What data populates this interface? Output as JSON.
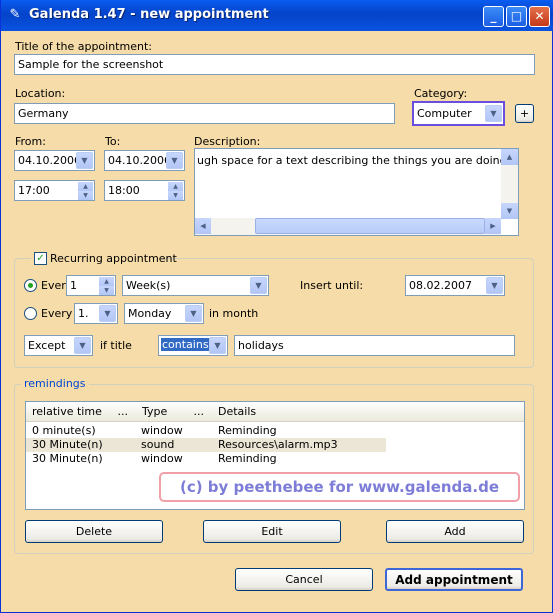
{
  "window": {
    "title": "Galenda 1.47 - new appointment",
    "min": "_",
    "max": "□",
    "close": "✕"
  },
  "appointment": {
    "title_label": "Title of the appointment:",
    "title_value": "Sample for the screenshot",
    "location_label": "Location:",
    "location_value": "Germany",
    "category_label": "Category:",
    "category_value": "Computer",
    "category_add": "+",
    "from_label": "From:",
    "to_label": "To:",
    "from_date": "04.10.2006",
    "to_date": "04.10.2006",
    "from_time": "17:00",
    "to_time": "18:00",
    "description_label": "Description:",
    "description_value": "ugh space for a text describing the things you are doing all the day."
  },
  "recurring": {
    "label": "Recurring appointment",
    "checked": true,
    "every_label": "Every",
    "every_value": "1",
    "every_unit": "Week(s)",
    "insert_until_label": "Insert until:",
    "insert_until_value": "08.02.2007",
    "every2_label": "Every",
    "nth_value": "1.",
    "weekday_value": "Monday",
    "in_month": "in month",
    "except_value": "Except",
    "if_title": "if title",
    "contains_value": "contains",
    "holidays_value": "holidays"
  },
  "remindings": {
    "label": "remindings",
    "columns": [
      "relative time",
      "Type",
      "Details"
    ],
    "col_more": "...",
    "rows": [
      [
        "0 minute(s)",
        "window",
        "Reminding"
      ],
      [
        "30 Minute(n)",
        "sound",
        "Resources\\alarm.mp3"
      ],
      [
        "30 Minute(n)",
        "window",
        "Reminding"
      ]
    ],
    "delete": "Delete",
    "edit": "Edit",
    "add": "Add"
  },
  "watermark": "(c) by peethebee for www.galenda.de",
  "footer": {
    "cancel": "Cancel",
    "add_appointment": "Add appointment"
  }
}
